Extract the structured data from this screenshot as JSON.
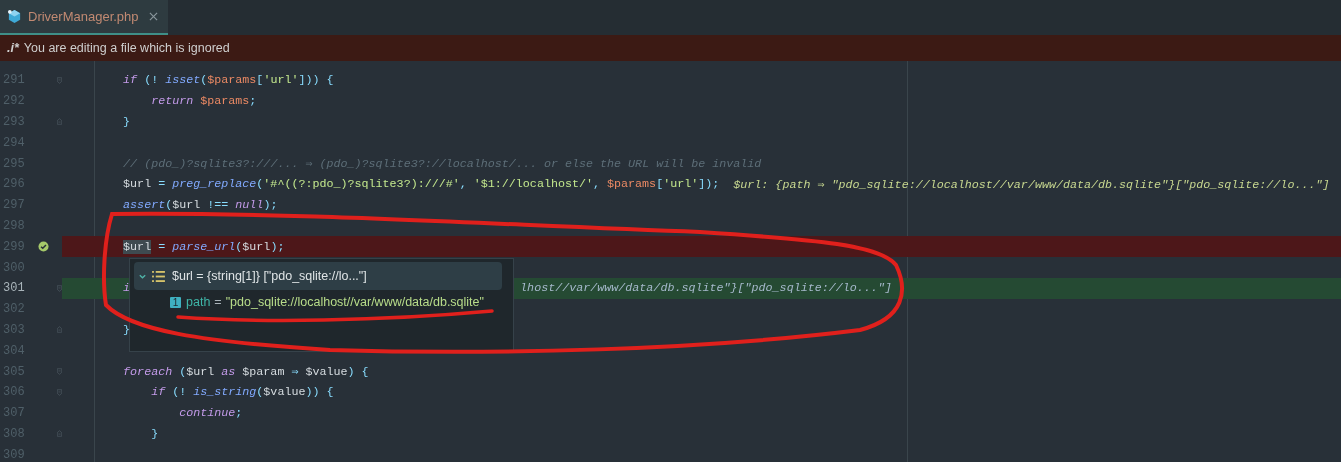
{
  "tab": {
    "label": "DriverManager.php",
    "selected": true
  },
  "banner": {
    "badge": ".i*",
    "text": "You are editing a file which is ignored"
  },
  "lines": [
    {
      "number": "291",
      "fold_start": true,
      "tokens": [
        {
          "kind": "keyword",
          "text": "if"
        },
        {
          "kind": "punct",
          "text": "(!",
          "gap": true
        },
        {
          "kind": "function",
          "text": "isset",
          "gap": true
        },
        {
          "kind": "punct",
          "text": "("
        },
        {
          "kind": "param",
          "text": "$params"
        },
        {
          "kind": "punct",
          "text": "["
        },
        {
          "kind": "string",
          "text": "'url'"
        },
        {
          "kind": "punct",
          "text": "]))"
        },
        {
          "kind": "punct",
          "text": "{",
          "gap": true
        }
      ]
    },
    {
      "number": "292",
      "tokens": [
        {
          "kind": "keyword",
          "text": "return"
        },
        {
          "kind": "param",
          "text": "$params",
          "gap": true
        },
        {
          "kind": "punct",
          "text": ";"
        }
      ]
    },
    {
      "number": "293",
      "fold_end": true,
      "tokens": [
        {
          "kind": "punct",
          "text": "}"
        }
      ]
    },
    {
      "number": "294"
    },
    {
      "number": "295",
      "tokens": [
        {
          "kind": "comment",
          "text": "// (pdo_)?sqlite3?:///... ⇒ (pdo_)?sqlite3?://localhost/... or else the URL will be invalid"
        }
      ]
    },
    {
      "number": "296",
      "tokens": [
        {
          "kind": "variable",
          "text": "$url"
        },
        {
          "kind": "punct",
          "text": "=",
          "gap": true
        },
        {
          "kind": "function",
          "text": "preg_replace",
          "gap": true
        },
        {
          "kind": "punct",
          "text": "("
        },
        {
          "kind": "string",
          "text": "'#^((?:pdo_)?sqlite3?):///#'"
        },
        {
          "kind": "punct",
          "text": ","
        },
        {
          "kind": "string",
          "text": "'$1://localhost/'",
          "gap": true
        },
        {
          "kind": "punct",
          "text": ","
        },
        {
          "kind": "param",
          "text": "$params",
          "gap": true
        },
        {
          "kind": "punct",
          "text": "["
        },
        {
          "kind": "string",
          "text": "'url'"
        },
        {
          "kind": "punct",
          "text": "]);"
        },
        {
          "kind": "hint",
          "text": "$url: {path ⇒ \"pdo_sqlite://localhost//var/www/data/db.sqlite\"}[\"pdo_sqlite://lo...\"]"
        }
      ]
    },
    {
      "number": "297",
      "tokens": [
        {
          "kind": "function",
          "text": "assert"
        },
        {
          "kind": "punct",
          "text": "("
        },
        {
          "kind": "variable",
          "text": "$url"
        },
        {
          "kind": "punct",
          "text": "!==",
          "gap": true
        },
        {
          "kind": "keyword",
          "text": "null",
          "gap": true
        },
        {
          "kind": "punct",
          "text": ");"
        }
      ]
    },
    {
      "number": "298"
    },
    {
      "number": "299",
      "breakpoint": true,
      "tokens": [
        {
          "kind": "usage",
          "text": "$url"
        },
        {
          "kind": "punct",
          "text": "=",
          "gap": true
        },
        {
          "kind": "function",
          "text": "parse_url",
          "gap": true
        },
        {
          "kind": "punct",
          "text": "("
        },
        {
          "kind": "variable",
          "text": "$url"
        },
        {
          "kind": "punct",
          "text": ");"
        }
      ]
    },
    {
      "number": "300"
    },
    {
      "number": "301",
      "execution": true,
      "fold_start": true,
      "tokens": [
        {
          "kind": "keyword",
          "text": "i"
        },
        {
          "kind": "tail",
          "text": "lhost//var/www/data/db.sqlite\"}[\"pdo_sqlite://lo...\"]"
        }
      ]
    },
    {
      "number": "302"
    },
    {
      "number": "303",
      "fold_end": true,
      "tokens": [
        {
          "kind": "punct",
          "text": "}"
        }
      ]
    },
    {
      "number": "304"
    },
    {
      "number": "305",
      "fold_start": true,
      "tokens": [
        {
          "kind": "keyword",
          "text": "foreach"
        },
        {
          "kind": "punct",
          "text": "(",
          "gap": true
        },
        {
          "kind": "variable",
          "text": "$url"
        },
        {
          "kind": "keyword",
          "text": "as",
          "gap": true
        },
        {
          "kind": "variable",
          "text": "$param",
          "gap": true
        },
        {
          "kind": "punct",
          "text": "⇒",
          "gap": true
        },
        {
          "kind": "variable",
          "text": "$value",
          "gap": true
        },
        {
          "kind": "punct",
          "text": ")"
        },
        {
          "kind": "punct",
          "text": "{",
          "gap": true
        }
      ]
    },
    {
      "number": "306",
      "fold_start": true,
      "tokens": [
        {
          "kind": "keyword",
          "text": "if"
        },
        {
          "kind": "punct",
          "text": "(!",
          "gap": true
        },
        {
          "kind": "function",
          "text": "is_string",
          "gap": true
        },
        {
          "kind": "punct",
          "text": "("
        },
        {
          "kind": "variable",
          "text": "$value"
        },
        {
          "kind": "punct",
          "text": "))"
        },
        {
          "kind": "punct",
          "text": "{",
          "gap": true
        }
      ]
    },
    {
      "number": "307",
      "tokens": [
        {
          "kind": "keyword",
          "text": "continue"
        },
        {
          "kind": "punct",
          "text": ";"
        }
      ]
    },
    {
      "number": "308",
      "fold_end": true,
      "tokens": [
        {
          "kind": "punct",
          "text": "}"
        }
      ]
    },
    {
      "number": "309"
    }
  ],
  "popup": {
    "header": {
      "expanded": true,
      "text": "$url = {string[1]} [\"pdo_sqlite://lo...\"]"
    },
    "children": [
      {
        "badge": "1",
        "name": "path",
        "equals": "=",
        "value": "\"pdo_sqlite://localhost//var/www/data/db.sqlite\""
      }
    ]
  },
  "markup": {
    "loop": true,
    "underline": true
  }
}
